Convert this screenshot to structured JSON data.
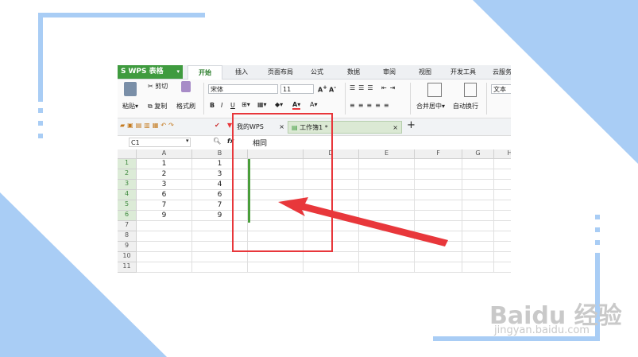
{
  "app": {
    "name": "WPS 表格"
  },
  "ribbon_tabs": [
    "开始",
    "插入",
    "页面布局",
    "公式",
    "数据",
    "审阅",
    "视图",
    "开发工具",
    "云服务"
  ],
  "active_tab": "开始",
  "ribbon": {
    "cut": "剪切",
    "paste": "粘贴",
    "copy": "复制",
    "format_painter": "格式刷",
    "font_name": "宋体",
    "font_size": "11",
    "merge_center": "合并居中",
    "wrap_text": "自动换行",
    "text_format": "文本"
  },
  "doc_tabs": [
    {
      "label": "我的WPS",
      "close": "×"
    },
    {
      "label": "工作簿1 *",
      "close": "×"
    }
  ],
  "new_tab": "+",
  "formula_bar": {
    "name_box": "C1",
    "fx": "fx",
    "value": "相同"
  },
  "columns": [
    "A",
    "B",
    "C",
    "D",
    "E",
    "F",
    "G",
    "H"
  ],
  "rows": [
    "1",
    "2",
    "3",
    "4",
    "5",
    "6",
    "7",
    "8",
    "9",
    "10",
    "11"
  ],
  "col_a": [
    "1",
    "2",
    "3",
    "6",
    "7",
    "9"
  ],
  "col_b": [
    "1",
    "3",
    "4",
    "6",
    "7",
    "9"
  ],
  "watermark": {
    "brand": "Baidu 经验",
    "url": "jingyan.baidu.com"
  },
  "colors": {
    "accent": "#3f9b3f",
    "frame": "#a9cdf5",
    "annotation": "#e8373b"
  }
}
